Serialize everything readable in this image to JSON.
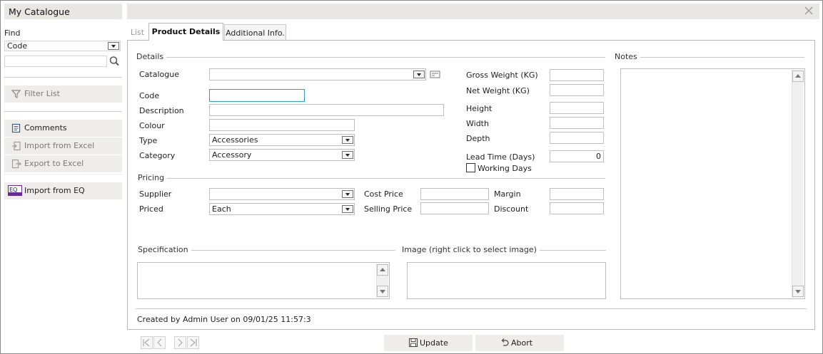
{
  "left_panel": {
    "title": "My Catalogue",
    "find_label": "Find",
    "find_field_value": "Code",
    "search_value": "",
    "filter_list": "Filter List",
    "comments": "Comments",
    "import_excel": "Import from Excel",
    "export_excel": "Export to Excel",
    "import_eq": "Import from EQ",
    "import_eq_badge": "EQ"
  },
  "tabs": [
    "List",
    "Product Details",
    "Additional Info."
  ],
  "active_tab": "Product Details",
  "details": {
    "section_title": "Details",
    "catalogue_label": "Catalogue",
    "catalogue_value": "",
    "code_label": "Code",
    "code_value": "",
    "description_label": "Description",
    "description_value": "",
    "colour_label": "Colour",
    "colour_value": "",
    "type_label": "Type",
    "type_value": "Accessories",
    "category_label": "Category",
    "category_value": "Accessory",
    "gross_weight_label": "Gross Weight (KG)",
    "gross_weight_value": "",
    "net_weight_label": "Net Weight (KG)",
    "net_weight_value": "",
    "height_label": "Height",
    "height_value": "",
    "width_label": "Width",
    "width_value": "",
    "depth_label": "Depth",
    "depth_value": "",
    "lead_time_label": "Lead Time (Days)",
    "lead_time_value": "0",
    "working_days_label": "Working Days",
    "working_days_checked": false
  },
  "pricing": {
    "section_title": "Pricing",
    "supplier_label": "Supplier",
    "supplier_value": "",
    "priced_label": "Priced",
    "priced_value": "Each",
    "cost_price_label": "Cost Price",
    "cost_price_value": "",
    "selling_price_label": "Selling Price",
    "selling_price_value": "",
    "margin_label": "Margin",
    "margin_value": "",
    "discount_label": "Discount",
    "discount_value": ""
  },
  "notes": {
    "section_title": "Notes",
    "value": ""
  },
  "specification": {
    "section_title": "Specification",
    "value": ""
  },
  "image": {
    "section_title": "Image  (right click to select image)"
  },
  "created_text": "Created by Admin User on 09/01/25 11:57:3",
  "buttons": {
    "update": "Update",
    "abort": "Abort"
  },
  "colors": {
    "panel_bg": "#e9e7e4",
    "button_bg": "#efedeb",
    "focus_border": "#3399cc",
    "eq_badge": "#6a2c91"
  }
}
